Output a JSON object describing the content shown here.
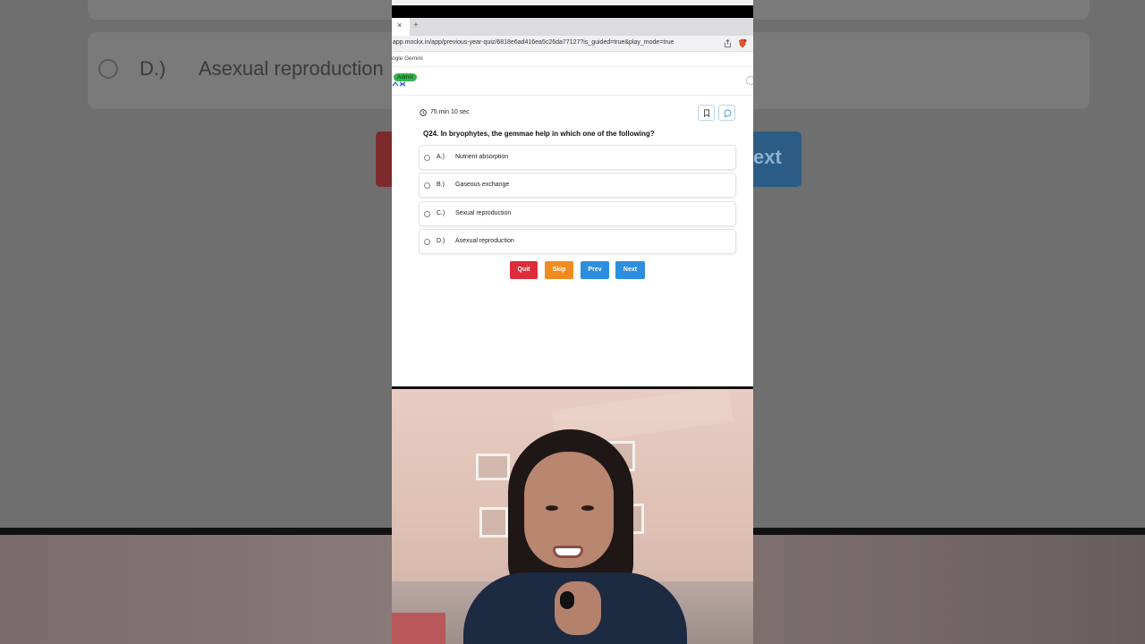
{
  "background": {
    "option_letter": "D.)",
    "option_text": "Asexual reproduction",
    "next_fragment": "ext"
  },
  "browser": {
    "tab_close": "×",
    "new_tab": "+",
    "url": "app.mockx.in/app/previous-year-quiz/6818e6ad416ea5c26da77127?is_guided=true&play_mode=true",
    "bookmark": "ogle Gemini"
  },
  "app": {
    "admin_badge": "Admin"
  },
  "quiz": {
    "timer": "75 min 10 sec",
    "question": "Q24. In bryophytes, the gemmae help in which one of the following?",
    "options": [
      {
        "letter": "A.)",
        "text": "Nutrient absorption"
      },
      {
        "letter": "B.)",
        "text": "Gaseous exchange"
      },
      {
        "letter": "C.)",
        "text": "Sexual reproduction"
      },
      {
        "letter": "D.)",
        "text": "Asexual reproduction"
      }
    ],
    "buttons": {
      "quit": "Quit",
      "skip": "Skip",
      "prev": "Prev",
      "next": "Next"
    }
  },
  "colors": {
    "quit": "#dc2c3a",
    "skip": "#f08c1d",
    "prev": "#2d8ee0",
    "next": "#2d8ee0",
    "admin_badge": "#37b24d"
  }
}
